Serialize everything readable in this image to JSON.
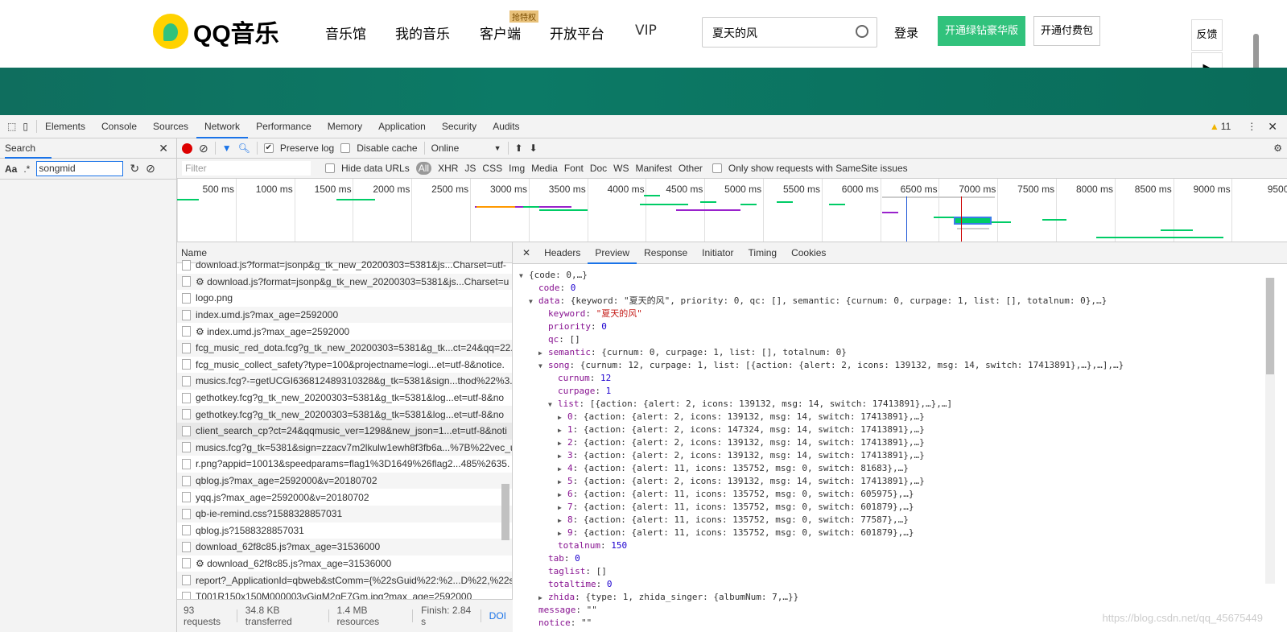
{
  "site": {
    "logo_text": "QQ音乐",
    "nav": [
      "音乐馆",
      "我的音乐",
      "客户端",
      "开放平台",
      "VIP"
    ],
    "nav_badge": "抢特权",
    "search_value": "夏天的风",
    "login": "登录",
    "green_button": "开通绿钻豪华版",
    "pay_button": "开通付费包",
    "feedback": "反馈",
    "accent": "#31c27c"
  },
  "devtools": {
    "tabs": [
      "Elements",
      "Console",
      "Sources",
      "Network",
      "Performance",
      "Memory",
      "Application",
      "Security",
      "Audits"
    ],
    "active_tab": "Network",
    "warnings": "11",
    "search_panel": {
      "title": "Search",
      "case_label": "Aa",
      "regex_label": ".*",
      "query": "songmid"
    },
    "toolbar": {
      "preserve_log": "Preserve log",
      "preserve_log_checked": true,
      "disable_cache": "Disable cache",
      "disable_cache_checked": false,
      "throttling": "Online"
    },
    "filter": {
      "placeholder": "Filter",
      "hide_data_urls": "Hide data URLs",
      "types": [
        "All",
        "XHR",
        "JS",
        "CSS",
        "Img",
        "Media",
        "Font",
        "Doc",
        "WS",
        "Manifest",
        "Other"
      ],
      "samesite": "Only show requests with SameSite issues"
    },
    "timeline_ticks": [
      "500 ms",
      "1000 ms",
      "1500 ms",
      "2000 ms",
      "2500 ms",
      "3000 ms",
      "3500 ms",
      "4000 ms",
      "4500 ms",
      "5000 ms",
      "5500 ms",
      "6000 ms",
      "6500 ms",
      "7000 ms",
      "7500 ms",
      "8000 ms",
      "8500 ms",
      "9000 ms",
      "9500"
    ],
    "list_header": "Name",
    "requests": [
      "download.js?format=jsonp&g_tk_new_20200303=5381&js...Charset=utf-",
      "⚙ download.js?format=jsonp&g_tk_new_20200303=5381&js...Charset=u",
      "logo.png",
      "index.umd.js?max_age=2592000",
      "⚙ index.umd.js?max_age=2592000",
      "fcg_music_red_dota.fcg?g_tk_new_20200303=5381&g_tk...ct=24&qq=22.",
      "fcg_music_collect_safety?type=100&projectname=logi...et=utf-8&notice.",
      "musics.fcg?-=getUCGI636812489310328&g_tk=5381&sign...thod%22%3.",
      "gethotkey.fcg?g_tk_new_20200303=5381&g_tk=5381&log...et=utf-8&no",
      "gethotkey.fcg?g_tk_new_20200303=5381&g_tk=5381&log...et=utf-8&no",
      "client_search_cp?ct=24&qqmusic_ver=1298&new_json=1...et=utf-8&noti",
      "musics.fcg?g_tk=5381&sign=zzacv7m2lkulw1ewh8f3fb6a...%7B%22vec_u",
      "r.png?appid=10013&speedparams=flag1%3D1649%26flag2...485%2635.",
      "qblog.js?max_age=2592000&v=20180702",
      "yqq.js?max_age=2592000&v=20180702",
      "qb-ie-remind.css?1588328857031",
      "qblog.js?1588328857031",
      "download_62f8c85.js?max_age=31536000",
      "⚙ download_62f8c85.js?max_age=31536000",
      "report?_ApplicationId=qbweb&stComm={%22sGuid%22:%2...D%22,%22s",
      "T001R150x150M000003vGiqM2qE7Gm.jpg?max_age=2592000"
    ],
    "status": {
      "requests": "93 requests",
      "transferred": "34.8 KB transferred",
      "resources": "1.4 MB resources",
      "finish": "Finish: 2.84 s",
      "dom": "DOI"
    },
    "preview_tabs": [
      "Headers",
      "Preview",
      "Response",
      "Initiator",
      "Timing",
      "Cookies"
    ],
    "active_preview_tab": "Preview",
    "tree": [
      {
        "d": 0,
        "t": "open",
        "k": "",
        "v": "{code: 0,…}"
      },
      {
        "d": 1,
        "t": "",
        "k": "code",
        "v": "0",
        "vt": "n"
      },
      {
        "d": 1,
        "t": "open",
        "k": "data",
        "v": "{keyword: \"夏天的风\", priority: 0, qc: [], semantic: {curnum: 0, curpage: 1, list: [], totalnum: 0},…}"
      },
      {
        "d": 2,
        "t": "",
        "k": "keyword",
        "v": "\"夏天的风\"",
        "vt": "s"
      },
      {
        "d": 2,
        "t": "",
        "k": "priority",
        "v": "0",
        "vt": "n"
      },
      {
        "d": 2,
        "t": "",
        "k": "qc",
        "v": "[]"
      },
      {
        "d": 2,
        "t": "closed",
        "k": "semantic",
        "v": "{curnum: 0, curpage: 1, list: [], totalnum: 0}"
      },
      {
        "d": 2,
        "t": "open",
        "k": "song",
        "v": "{curnum: 12, curpage: 1, list: [{action: {alert: 2, icons: 139132, msg: 14, switch: 17413891},…},…],…}"
      },
      {
        "d": 3,
        "t": "",
        "k": "curnum",
        "v": "12",
        "vt": "n"
      },
      {
        "d": 3,
        "t": "",
        "k": "curpage",
        "v": "1",
        "vt": "n"
      },
      {
        "d": 3,
        "t": "open",
        "k": "list",
        "v": "[{action: {alert: 2, icons: 139132, msg: 14, switch: 17413891},…},…]"
      },
      {
        "d": 4,
        "t": "closed",
        "k": "0",
        "v": "{action: {alert: 2, icons: 139132, msg: 14, switch: 17413891},…}"
      },
      {
        "d": 4,
        "t": "closed",
        "k": "1",
        "v": "{action: {alert: 2, icons: 147324, msg: 14, switch: 17413891},…}"
      },
      {
        "d": 4,
        "t": "closed",
        "k": "2",
        "v": "{action: {alert: 2, icons: 139132, msg: 14, switch: 17413891},…}"
      },
      {
        "d": 4,
        "t": "closed",
        "k": "3",
        "v": "{action: {alert: 2, icons: 139132, msg: 14, switch: 17413891},…}"
      },
      {
        "d": 4,
        "t": "closed",
        "k": "4",
        "v": "{action: {alert: 11, icons: 135752, msg: 0, switch: 81683},…}"
      },
      {
        "d": 4,
        "t": "closed",
        "k": "5",
        "v": "{action: {alert: 2, icons: 139132, msg: 14, switch: 17413891},…}"
      },
      {
        "d": 4,
        "t": "closed",
        "k": "6",
        "v": "{action: {alert: 11, icons: 135752, msg: 0, switch: 605975},…}"
      },
      {
        "d": 4,
        "t": "closed",
        "k": "7",
        "v": "{action: {alert: 11, icons: 135752, msg: 0, switch: 601879},…}"
      },
      {
        "d": 4,
        "t": "closed",
        "k": "8",
        "v": "{action: {alert: 11, icons: 135752, msg: 0, switch: 77587},…}"
      },
      {
        "d": 4,
        "t": "closed",
        "k": "9",
        "v": "{action: {alert: 11, icons: 135752, msg: 0, switch: 601879},…}"
      },
      {
        "d": 3,
        "t": "",
        "k": "totalnum",
        "v": "150",
        "vt": "n"
      },
      {
        "d": 2,
        "t": "",
        "k": "tab",
        "v": "0",
        "vt": "n"
      },
      {
        "d": 2,
        "t": "",
        "k": "taglist",
        "v": "[]"
      },
      {
        "d": 2,
        "t": "",
        "k": "totaltime",
        "v": "0",
        "vt": "n"
      },
      {
        "d": 2,
        "t": "closed",
        "k": "zhida",
        "v": "{type: 1, zhida_singer: {albumNum: 7,…}}"
      },
      {
        "d": 1,
        "t": "",
        "k": "message",
        "v": "\"\""
      },
      {
        "d": 1,
        "t": "",
        "k": "notice",
        "v": "\"\""
      }
    ]
  },
  "watermark": "https://blog.csdn.net/qq_45675449"
}
